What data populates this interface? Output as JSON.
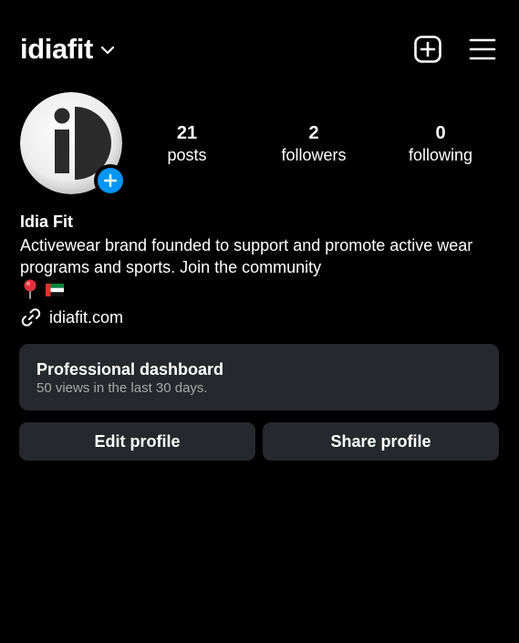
{
  "header": {
    "username": "idiafit",
    "icons": [
      "chevron-down-icon",
      "create-post-icon",
      "menu-icon"
    ]
  },
  "profile": {
    "stats": {
      "posts": {
        "value": "21",
        "label": "posts"
      },
      "followers": {
        "value": "2",
        "label": "followers"
      },
      "following": {
        "value": "0",
        "label": "following"
      }
    },
    "name": "Idia Fit",
    "bio": "Activewear brand founded to support and promote active wear programs and sports. Join the community",
    "bio_emojis": [
      "round-pushpin-emoji",
      "uae-flag-emoji"
    ],
    "link": "idiafit.com"
  },
  "dashboard": {
    "title": "Professional dashboard",
    "subtitle": "50 views in the last 30 days."
  },
  "actions": {
    "edit_label": "Edit profile",
    "share_label": "Share profile"
  },
  "colors": {
    "background": "#000000",
    "card": "#25282c",
    "accent": "#0095f6",
    "secondary_text": "#a8a8a8"
  }
}
